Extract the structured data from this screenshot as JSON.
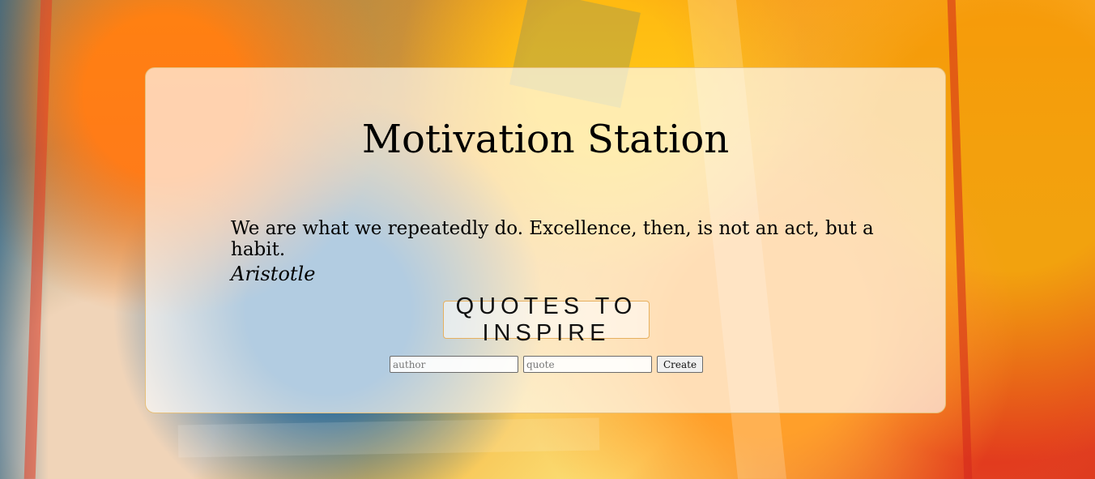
{
  "app": {
    "title": "Motivation Station"
  },
  "quote": {
    "text": "We are what we repeatedly do. Excellence, then, is not an act, but a habit.",
    "author": "Aristotle"
  },
  "inspire_button": {
    "label": "Quotes to Inspire"
  },
  "create_form": {
    "author_placeholder": "author",
    "quote_placeholder": "quote",
    "create_label": "Create"
  },
  "colors": {
    "panel_border": "#e7c07a",
    "button_border": "#e6b060"
  }
}
